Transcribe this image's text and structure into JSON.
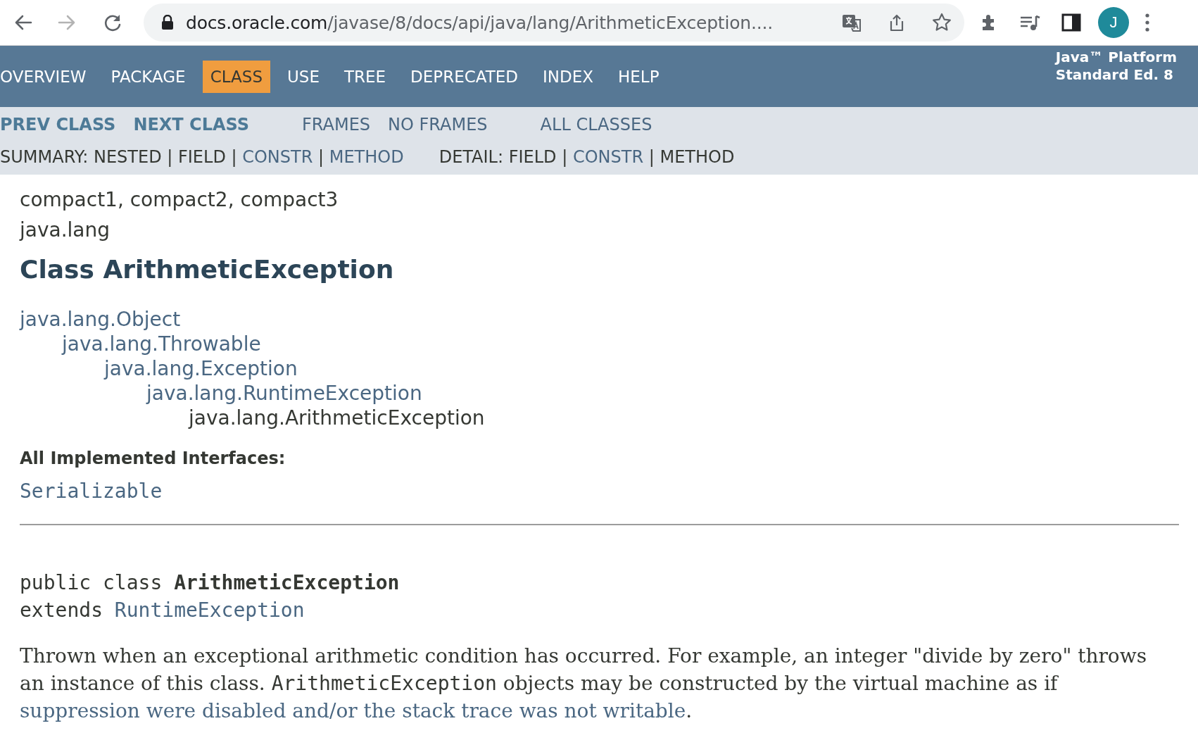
{
  "browser": {
    "url_host": "docs.oracle.com",
    "url_path": "/javase/8/docs/api/java/lang/ArithmeticException....",
    "back_disabled": false,
    "forward_disabled": true,
    "avatar_letter": "J"
  },
  "nav": {
    "items": [
      {
        "label": "OVERVIEW",
        "selected": false
      },
      {
        "label": "PACKAGE",
        "selected": false
      },
      {
        "label": "CLASS",
        "selected": true
      },
      {
        "label": "USE",
        "selected": false
      },
      {
        "label": "TREE",
        "selected": false
      },
      {
        "label": "DEPRECATED",
        "selected": false
      },
      {
        "label": "INDEX",
        "selected": false
      },
      {
        "label": "HELP",
        "selected": false
      }
    ],
    "about_lines": [
      "Java™ Platform",
      "Standard Ed. 8"
    ]
  },
  "subnav": {
    "groups": [
      [
        {
          "label": "PREV CLASS",
          "kind": "strong"
        },
        {
          "label": "NEXT CLASS",
          "kind": "strong"
        }
      ],
      [
        {
          "label": "FRAMES",
          "kind": "link"
        },
        {
          "label": "NO FRAMES",
          "kind": "link"
        }
      ],
      [
        {
          "label": "ALL CLASSES",
          "kind": "link"
        }
      ]
    ],
    "summary": [
      {
        "text": "SUMMARY: NESTED | FIELD | ",
        "kind": "text"
      },
      {
        "text": "CONSTR",
        "kind": "link"
      },
      {
        "text": " | ",
        "kind": "text"
      },
      {
        "text": "METHOD",
        "kind": "link"
      }
    ],
    "detail": [
      {
        "text": "DETAIL: FIELD | ",
        "kind": "text"
      },
      {
        "text": "CONSTR",
        "kind": "link"
      },
      {
        "text": " | METHOD",
        "kind": "text"
      }
    ]
  },
  "content": {
    "profiles": "compact1, compact2, compact3",
    "package": "java.lang",
    "title": "Class ArithmeticException",
    "inheritance": [
      {
        "text": "java.lang.Object",
        "link": true
      },
      {
        "text": "java.lang.Throwable",
        "link": true
      },
      {
        "text": "java.lang.Exception",
        "link": true
      },
      {
        "text": "java.lang.RuntimeException",
        "link": true
      },
      {
        "text": "java.lang.ArithmeticException",
        "link": false
      }
    ],
    "interfaces_label": "All Implemented Interfaces:",
    "interfaces": [
      "Serializable"
    ],
    "signature": {
      "prefix": "public class ",
      "name": "ArithmeticException",
      "extends_word": "extends ",
      "superclass": "RuntimeException"
    },
    "description": [
      {
        "kind": "text",
        "text": "Thrown when an exceptional arithmetic condition has occurred. For example, an integer \"divide by zero\" throws an instance of this class. "
      },
      {
        "kind": "code",
        "text": "ArithmeticException"
      },
      {
        "kind": "text",
        "text": " objects may be constructed by the virtual machine as if "
      },
      {
        "kind": "link",
        "text": "suppression were disabled and/or the stack trace was not writable"
      },
      {
        "kind": "text",
        "text": "."
      }
    ]
  }
}
